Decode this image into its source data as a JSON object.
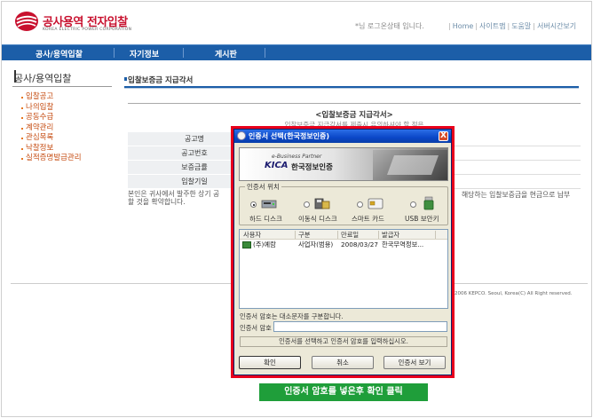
{
  "header": {
    "brand": "공사용역 전자입찰",
    "brand_sub": "KOREA ELECTRIC POWER CORPORATION",
    "status_msg": "*님 로그온상태 입니다.",
    "links": [
      "Home",
      "사이트맵",
      "도움말",
      "서버시간보기"
    ],
    "brand_color": "#c8102e"
  },
  "nav": {
    "items": [
      "공사/용역입찰",
      "자기정보",
      "게시판"
    ],
    "color": "#1c5ea8"
  },
  "sidebar": {
    "title": "공사/용역입찰",
    "items": [
      "입찰공고",
      "나의입찰",
      "공동수급",
      "계약관리",
      "관심목록",
      "낙찰정보",
      "실적증명발급관리"
    ]
  },
  "content": {
    "title": "입찰보증금 지급각서",
    "form_title": "<입찰보증금 지급각서>",
    "notice": "입찰보증금 지급각서를 제출시 유의하셔야 할 점은",
    "rows": [
      "공고명",
      "공고번호",
      "보증금률",
      "입찰기일"
    ],
    "body_left": "본인은 귀사에서 발주한 상기 공",
    "body_left2": "할 것을 확약합니다.",
    "body_right": "해당하는 입찰보증금을 현금으로 납부",
    "copyright": "2006 KEPCO. Seoul, Korea(C) All Right reserved."
  },
  "dialog": {
    "title": "인증서 선택(한국정보인증)",
    "close_label": "X",
    "banner": {
      "partner": "e-Business Partner",
      "logo": "KICA",
      "name": "한국정보인증"
    },
    "location_label": "인증서 위치",
    "locations": [
      {
        "label": "하드 디스크",
        "icon": "hard-disk-icon",
        "selected": true
      },
      {
        "label": "이동식 디스크",
        "icon": "removable-disk-icon",
        "selected": false
      },
      {
        "label": "스마트 카드",
        "icon": "smart-card-icon",
        "selected": false
      },
      {
        "label": "USB 보안키",
        "icon": "usb-key-icon",
        "selected": false
      }
    ],
    "columns": [
      "사용자",
      "구분",
      "만료일",
      "발급자"
    ],
    "rows": [
      {
        "user": "(주)예람",
        "type": "사업자(범용)",
        "expires": "2008/03/27",
        "issuer": "한국무역정보..."
      }
    ],
    "hint": "인증서 암호는 대소문자를 구분합니다.",
    "password_label": "인증서 암호",
    "password_value": "",
    "message": "인증서를 선택하고 인증서 암호를 입력하십시오.",
    "buttons": [
      "확인",
      "취소",
      "인증서 보기"
    ]
  },
  "caption": {
    "text": "인증서 암호를 넣은후 확인 클릭",
    "color": "#1f9e3a"
  }
}
